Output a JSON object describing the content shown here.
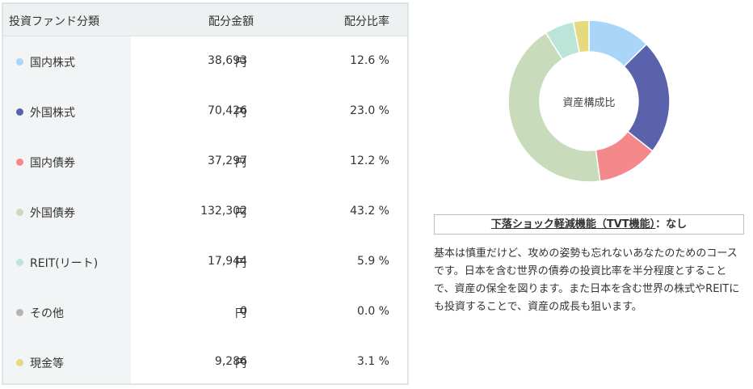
{
  "table": {
    "header": {
      "category": "投資ファンド分類",
      "amount": "配分金額",
      "ratio": "配分比率"
    },
    "rows": [
      {
        "name": "国内株式",
        "amount": "38,693",
        "unit": "円",
        "ratio": "12.6 %",
        "color": "#a9d6f8",
        "value": 12.6
      },
      {
        "name": "外国株式",
        "amount": "70,426",
        "unit": "円",
        "ratio": "23.0 %",
        "color": "#5a62ac",
        "value": 23.0
      },
      {
        "name": "国内債券",
        "amount": "37,297",
        "unit": "円",
        "ratio": "12.2 %",
        "color": "#f5888a",
        "value": 12.2
      },
      {
        "name": "外国債券",
        "amount": "132,302",
        "unit": "円",
        "ratio": "43.2 %",
        "color": "#c8dcbc",
        "value": 43.2
      },
      {
        "name": "REIT(リート)",
        "amount": "17,944",
        "unit": "円",
        "ratio": "5.9 %",
        "color": "#bde4d8",
        "value": 5.9
      },
      {
        "name": "その他",
        "amount": "0",
        "unit": "円",
        "ratio": "0.0 %",
        "color": "#b4b4b4",
        "value": 0.0
      },
      {
        "name": "現金等",
        "amount": "9,286",
        "unit": "円",
        "ratio": "3.1 %",
        "color": "#e6da80",
        "value": 3.1
      }
    ]
  },
  "chart_data": {
    "type": "pie",
    "center_label": "資産構成比",
    "categories": [
      "国内株式",
      "外国株式",
      "国内債券",
      "外国債券",
      "REIT(リート)",
      "その他",
      "現金等"
    ],
    "values": [
      12.6,
      23.0,
      12.2,
      43.2,
      5.9,
      0.0,
      3.1
    ],
    "colors": [
      "#a9d6f8",
      "#5a62ac",
      "#f5888a",
      "#c8dcbc",
      "#bde4d8",
      "#b4b4b4",
      "#e6da80"
    ]
  },
  "tvt": {
    "label": "下落ショック軽減機能（TVT機能）",
    "suffix": "：なし"
  },
  "description": "基本は慎重だけど、攻めの姿勢も忘れないあなたのためのコースです。日本を含む世界の債券の投資比率を半分程度とすることで、資産の保全を図ります。また日本を含む世界の株式やREITにも投資することで、資産の成長も狙います。"
}
